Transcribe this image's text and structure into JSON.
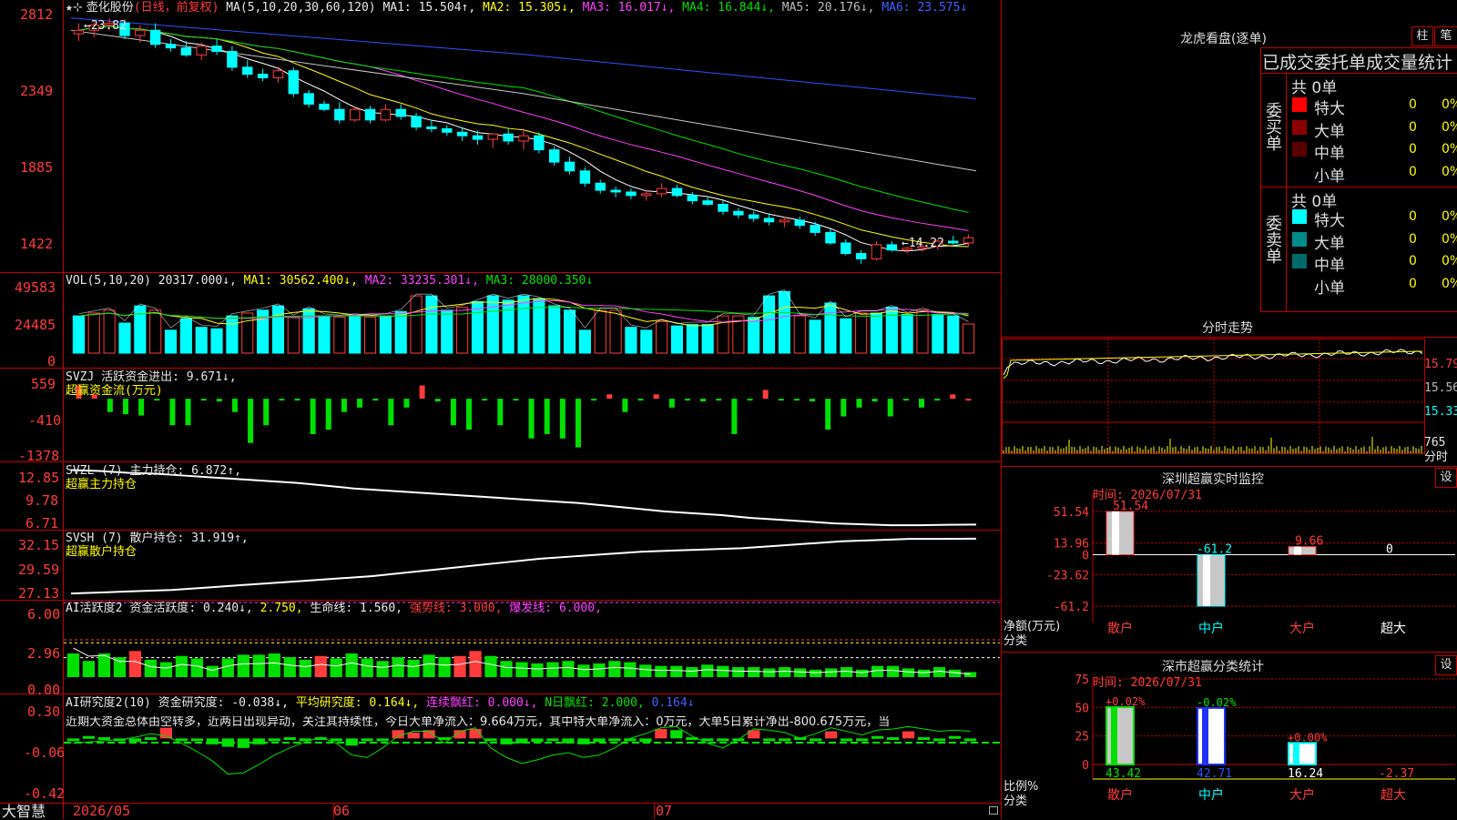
{
  "app_name": "大智慧",
  "main": {
    "stock": "壶化股份",
    "period": "(日线，前复权)",
    "ma_title": "MA(5,10,20,30,60,120)",
    "ma1": "MA1: 15.504↑,",
    "ma2": "MA2: 15.305↓,",
    "ma3": "MA3: 16.017↓,",
    "ma4": "MA4: 16.844↓,",
    "ma5": "MA5: 20.176↓,",
    "ma6": "MA6: 23.575↓",
    "y_ticks": [
      "2812",
      "2349",
      "1885",
      "1422"
    ],
    "high_label": "←23.82",
    "low_label": "←14.22",
    "colors": {
      "up": "#ff3b3b",
      "down": "#00ffff",
      "ma1": "#ffffff",
      "ma2": "#ffff00",
      "ma3": "#ff40ff",
      "ma4": "#00e000",
      "ma5": "#c8c8c8",
      "ma6": "#3050ff"
    }
  },
  "vol": {
    "title": "VOL(5,10,20)",
    "value": "20317.000↓,",
    "ma1": "MA1: 30562.400↓,",
    "ma2": "MA2: 33235.301↓,",
    "ma3": "MA3: 28000.350↓",
    "y_ticks": [
      "49583",
      "24485",
      "0"
    ]
  },
  "svzj": {
    "title": "SVZJ",
    "label": "活跃资金进出: 9.671↓,",
    "sub": "超赢资金流(万元)",
    "y_ticks": [
      "559",
      "-410",
      "-1378"
    ]
  },
  "svzl": {
    "title": "SVZL (7)",
    "label": "主力持仓: 6.872↑,",
    "sub": "超赢主力持仓",
    "y_ticks": [
      "12.85",
      "9.78",
      "6.71"
    ]
  },
  "svsh": {
    "title": "SVSH (7)",
    "label": "散户持仓: 31.919↑,",
    "sub": "超赢散户持仓",
    "y_ticks": [
      "32.15",
      "29.59",
      "27.13"
    ]
  },
  "ai_act": {
    "title": "AI活跃度2",
    "a": "资金活跃度: 0.240↓,",
    "b": "2.750,",
    "c": "生命线: 1.560,",
    "d": "强势线: 3.000,",
    "e": "爆发线: 6.000,",
    "y_ticks": [
      "6.00",
      "2.96",
      "0.00"
    ]
  },
  "ai_res": {
    "title": "AI研究度2(10)",
    "a": "资金研究度: -0.038↓,",
    "b": "平均研究度: 0.164↓,",
    "c": "连续飘红: 0.000↓,",
    "d": "N日飘红: 2.000,",
    "e": "0.164↓",
    "comment": "近期大资金总体由空转多，近两日出现异动，关注其持续性，今日大单净流入：9.664万元，其中特大单净流入：0万元，大单5日累计净出-800.675万元，当",
    "y_ticks": [
      "0.30",
      "-0.06",
      "-0.42"
    ]
  },
  "x_axis": [
    "2026/05",
    "06",
    "07"
  ],
  "longhu": {
    "title": "龙虎看盘(逐单)",
    "btn1": "柱",
    "btn2": "笔",
    "header": "已成交委托单成交量统计",
    "buy_label": "委买单",
    "sell_label": "委卖单",
    "buy_total": "共 0单",
    "sell_total": "共 0单",
    "buy_rows": [
      {
        "name": "特大",
        "count": "0",
        "pct": "0%",
        "color": "#ff0000"
      },
      {
        "name": "大单",
        "count": "0",
        "pct": "0%",
        "color": "#8b0000"
      },
      {
        "name": "中单",
        "count": "0",
        "pct": "0%",
        "color": "#5a0000"
      },
      {
        "name": "小单",
        "count": "0",
        "pct": "0%",
        "color": "#000000"
      }
    ],
    "sell_rows": [
      {
        "name": "特大",
        "count": "0",
        "pct": "0%",
        "color": "#00ffff"
      },
      {
        "name": "大单",
        "count": "0",
        "pct": "0%",
        "color": "#008b8b"
      },
      {
        "name": "中单",
        "count": "0",
        "pct": "0%",
        "color": "#006a6a"
      },
      {
        "name": "小单",
        "count": "0",
        "pct": "0%",
        "color": "#000000"
      }
    ]
  },
  "fenshi": {
    "title": "分时走势",
    "p1": "15.79",
    "p2": "15.56",
    "p3": "15.33",
    "vol": "765",
    "unit": "分时"
  },
  "monitor": {
    "title": "深圳超赢实时监控",
    "btn": "设",
    "time": "时间: 2026/07/31",
    "y_ticks": [
      "51.54",
      "13.96",
      "0",
      "-23.62",
      "-61.2"
    ],
    "ylabel": "净额(万元)",
    "xlabel": "分类",
    "categories": [
      "散户",
      "中户",
      "大户",
      "超大"
    ],
    "values": [
      51.54,
      -61.2,
      9.66,
      0
    ],
    "value_labels": [
      "51.54",
      "-61.2",
      "9.66",
      "0"
    ]
  },
  "classify": {
    "title": "深市超赢分类统计",
    "btn": "设",
    "time": "时间: 2026/07/31",
    "y_ticks": [
      "75",
      "50",
      "25",
      "0"
    ],
    "ylabel": "比例%",
    "xlabel": "分类",
    "categories": [
      "散户",
      "中户",
      "大户",
      "超大"
    ],
    "top_labels": [
      "+0.02%",
      "-0.02%",
      "+0.00%",
      ""
    ],
    "bottom_labels": [
      "43.42",
      "42.71",
      "16.24",
      "-2.37"
    ],
    "values": [
      43.42,
      42.71,
      16.24,
      -2.37
    ]
  },
  "chart_data": [
    {
      "type": "candlestick",
      "title": "壶化股份 (日线，前复权)",
      "ylim": [
        14.0,
        28.5
      ],
      "ohlc": [
        [
          27.3,
          27.9,
          26.9,
          27.5
        ],
        [
          27.5,
          28.0,
          27.1,
          27.8
        ],
        [
          27.8,
          28.2,
          27.5,
          27.9
        ],
        [
          27.9,
          28.1,
          27.0,
          27.2
        ],
        [
          27.2,
          27.8,
          26.8,
          27.5
        ],
        [
          27.5,
          27.9,
          26.5,
          26.7
        ],
        [
          26.7,
          27.0,
          26.3,
          26.5
        ],
        [
          26.5,
          26.9,
          26.0,
          26.1
        ],
        [
          26.1,
          26.8,
          25.8,
          26.6
        ],
        [
          26.6,
          27.0,
          26.1,
          26.3
        ],
        [
          26.3,
          26.6,
          25.2,
          25.4
        ],
        [
          25.4,
          25.8,
          24.8,
          25.0
        ],
        [
          25.0,
          25.3,
          24.6,
          24.8
        ],
        [
          24.8,
          25.4,
          24.5,
          25.2
        ],
        [
          25.2,
          25.4,
          23.7,
          23.9
        ],
        [
          23.9,
          24.1,
          23.1,
          23.3
        ],
        [
          23.3,
          23.5,
          22.9,
          23.0
        ],
        [
          23.0,
          23.4,
          22.2,
          22.4
        ],
        [
          22.4,
          23.2,
          22.3,
          23.0
        ],
        [
          23.0,
          23.2,
          22.2,
          22.4
        ],
        [
          22.4,
          23.3,
          22.3,
          23.0
        ],
        [
          23.0,
          23.3,
          22.4,
          22.6
        ],
        [
          22.6,
          22.8,
          21.8,
          22.0
        ],
        [
          22.0,
          22.4,
          21.7,
          21.9
        ],
        [
          21.9,
          22.1,
          21.5,
          21.7
        ],
        [
          21.7,
          22.0,
          21.2,
          21.5
        ],
        [
          21.5,
          21.8,
          21.0,
          21.3
        ],
        [
          21.3,
          21.6,
          20.8,
          21.6
        ],
        [
          21.6,
          21.9,
          21.0,
          21.2
        ],
        [
          21.2,
          21.9,
          20.7,
          21.5
        ],
        [
          21.5,
          21.7,
          20.5,
          20.7
        ],
        [
          20.7,
          20.9,
          19.8,
          20.0
        ],
        [
          20.0,
          20.3,
          19.3,
          19.5
        ],
        [
          19.5,
          19.7,
          18.6,
          18.8
        ],
        [
          18.8,
          19.0,
          18.2,
          18.4
        ],
        [
          18.4,
          18.6,
          18.0,
          18.3
        ],
        [
          18.3,
          18.5,
          17.9,
          18.1
        ],
        [
          18.1,
          18.4,
          17.8,
          18.2
        ],
        [
          18.2,
          18.8,
          18.0,
          18.5
        ],
        [
          18.5,
          18.7,
          18.0,
          18.1
        ],
        [
          18.1,
          18.3,
          17.6,
          17.8
        ],
        [
          17.8,
          18.0,
          17.5,
          17.6
        ],
        [
          17.6,
          17.8,
          17.0,
          17.2
        ],
        [
          17.2,
          17.4,
          16.8,
          17.0
        ],
        [
          17.0,
          17.2,
          16.6,
          16.8
        ],
        [
          16.8,
          17.1,
          16.4,
          16.6
        ],
        [
          16.6,
          16.9,
          16.3,
          16.7
        ],
        [
          16.7,
          16.9,
          16.2,
          16.4
        ],
        [
          16.4,
          16.6,
          15.8,
          16.0
        ],
        [
          16.0,
          16.2,
          15.3,
          15.4
        ],
        [
          15.4,
          15.6,
          14.7,
          14.8
        ],
        [
          14.8,
          15.0,
          14.2,
          14.5
        ],
        [
          14.5,
          15.5,
          14.4,
          15.3
        ],
        [
          15.3,
          15.5,
          14.9,
          15.0
        ],
        [
          15.0,
          15.2,
          14.8,
          15.1
        ],
        [
          15.1,
          15.3,
          14.9,
          15.2
        ],
        [
          15.2,
          15.6,
          15.0,
          15.5
        ],
        [
          15.5,
          15.8,
          15.3,
          15.4
        ],
        [
          15.4,
          15.9,
          15.2,
          15.7
        ]
      ],
      "ma_series": [
        {
          "name": "MA1"
        },
        {
          "name": "MA2"
        },
        {
          "name": "MA3"
        },
        {
          "name": "MA4"
        },
        {
          "name": "MA5"
        },
        {
          "name": "MA6"
        }
      ]
    },
    {
      "type": "bar",
      "title": "VOL(5,10,20)",
      "ylim": [
        0,
        49583
      ],
      "values": [
        26000,
        28000,
        30000,
        21000,
        33000,
        30000,
        16000,
        24000,
        18000,
        17000,
        26000,
        28000,
        30000,
        33000,
        25000,
        31000,
        26000,
        25000,
        26000,
        25000,
        26000,
        29000,
        40000,
        40000,
        30000,
        32000,
        36000,
        40000,
        37000,
        40000,
        38000,
        33000,
        30000,
        16000,
        30000,
        30000,
        18000,
        16000,
        22000,
        19000,
        20000,
        20000,
        26000,
        26000,
        25000,
        40000,
        43000,
        26000,
        23000,
        35000,
        24000,
        28000,
        28000,
        32000,
        27000,
        30000,
        27000,
        26000,
        20317
      ],
      "up": [
        0,
        1,
        1,
        0,
        0,
        1,
        0,
        0,
        0,
        0,
        0,
        1,
        0,
        0,
        1,
        0,
        0,
        1,
        0,
        1,
        0,
        0,
        1,
        0,
        0,
        1,
        0,
        0,
        0,
        0,
        0,
        0,
        0,
        0,
        1,
        1,
        0,
        0,
        1,
        0,
        0,
        0,
        1,
        1,
        0,
        0,
        0,
        1,
        0,
        0,
        0,
        1,
        0,
        0,
        0,
        1,
        0,
        0,
        1
      ]
    },
    {
      "type": "bar",
      "title": "SVZJ 活跃资金进出",
      "ylim": [
        -1378,
        559
      ],
      "values": [
        300,
        100,
        -300,
        -350,
        -380,
        -40,
        -600,
        -600,
        -40,
        -60,
        -300,
        -1000,
        -600,
        -40,
        -40,
        -800,
        -700,
        -300,
        -200,
        -40,
        -600,
        -200,
        300,
        -60,
        -600,
        -700,
        -40,
        -600,
        -40,
        -900,
        -800,
        -900,
        -1100,
        -40,
        100,
        -300,
        -40,
        100,
        -200,
        -40,
        -60,
        -40,
        -800,
        -40,
        200,
        -30,
        -30,
        -60,
        -700,
        -400,
        -200,
        -60,
        -400,
        -40,
        -200,
        -40,
        100,
        -10
      ],
      "up": [
        1,
        1,
        0,
        0,
        0,
        0,
        0,
        0,
        0,
        0,
        0,
        0,
        0,
        0,
        0,
        0,
        0,
        0,
        0,
        0,
        0,
        0,
        1,
        0,
        0,
        0,
        0,
        0,
        0,
        0,
        0,
        0,
        0,
        0,
        1,
        0,
        0,
        1,
        0,
        0,
        0,
        0,
        0,
        0,
        1,
        0,
        0,
        0,
        0,
        0,
        0,
        0,
        0,
        0,
        0,
        0,
        1,
        1
      ]
    },
    {
      "type": "line",
      "title": "SVZL 主力持仓",
      "ylim": [
        6.71,
        12.85
      ],
      "values": [
        12.8,
        12.7,
        12.5,
        12.4,
        12.2,
        12.0,
        11.8,
        11.6,
        11.4,
        11.1,
        10.8,
        10.6,
        10.4,
        10.2,
        10.0,
        9.8,
        9.6,
        9.4,
        9.2,
        8.9,
        8.6,
        8.3,
        8.1,
        7.9,
        7.6,
        7.4,
        7.2,
        7.0,
        6.9,
        6.8,
        6.8,
        6.85,
        6.87
      ]
    },
    {
      "type": "line",
      "title": "SVSH 散户持仓",
      "ylim": [
        27.13,
        32.15
      ],
      "values": [
        27.2,
        27.3,
        27.4,
        27.5,
        27.7,
        27.9,
        28.1,
        28.3,
        28.5,
        28.7,
        29.0,
        29.3,
        29.6,
        29.9,
        30.2,
        30.4,
        30.6,
        30.8,
        30.9,
        31.0,
        31.1,
        31.3,
        31.5,
        31.7,
        31.8,
        31.9,
        31.9,
        31.92
      ]
    },
    {
      "type": "bar",
      "title": "AI活跃度2",
      "ylim": [
        0,
        6
      ],
      "values": [
        1.9,
        1.3,
        1.9,
        1.6,
        2.1,
        1.4,
        1.2,
        1.7,
        1.5,
        0.9,
        1.5,
        1.8,
        1.8,
        1.9,
        1.6,
        1.4,
        1.7,
        1.5,
        1.9,
        1.5,
        1.3,
        1.6,
        1.4,
        1.8,
        1.6,
        1.7,
        2.1,
        1.7,
        1.3,
        1.2,
        1.1,
        1.2,
        1.3,
        1.0,
        1.1,
        1.3,
        1.2,
        1.0,
        0.9,
        0.9,
        0.8,
        1.0,
        0.9,
        0.8,
        0.8,
        0.7,
        0.8,
        0.7,
        0.6,
        0.7,
        0.8,
        0.6,
        0.9,
        0.9,
        0.7,
        0.6,
        0.8,
        0.6,
        0.4
      ],
      "up": [
        0,
        0,
        0,
        0,
        1,
        0,
        0,
        0,
        0,
        0,
        0,
        0,
        0,
        0,
        0,
        0,
        1,
        0,
        0,
        0,
        0,
        0,
        0,
        0,
        0,
        1,
        1,
        0,
        0,
        0,
        0,
        0,
        0,
        0,
        0,
        0,
        0,
        0,
        0,
        0,
        0,
        0,
        0,
        0,
        0,
        0,
        0,
        0,
        0,
        0,
        0,
        0,
        0,
        0,
        0,
        0,
        0,
        0,
        0
      ]
    },
    {
      "type": "bar",
      "title": "AI研究度2(10)",
      "ylim": [
        -0.42,
        0.3
      ],
      "values": [
        -0.05,
        -0.02,
        -0.03,
        -0.06,
        -0.07,
        -0.03,
        0.05,
        -0.05,
        -0.06,
        -0.09,
        -0.11,
        -0.12,
        -0.09,
        -0.05,
        -0.03,
        -0.05,
        -0.03,
        -0.05,
        -0.1,
        -0.04,
        -0.06,
        0.03,
        0.01,
        0.03,
        -0.03,
        0.03,
        0.04,
        -0.06,
        -0.09,
        -0.08,
        -0.07,
        -0.06,
        -0.08,
        -0.09,
        -0.07,
        -0.06,
        -0.05,
        -0.07,
        0.04,
        0.03,
        -0.03,
        -0.04,
        -0.05,
        -0.05,
        0.03,
        -0.06,
        -0.04,
        -0.03,
        -0.05,
        0.02,
        -0.06,
        -0.04,
        -0.02,
        -0.03,
        0.02,
        -0.03,
        -0.04,
        -0.02,
        -0.04
      ],
      "up": [
        0,
        0,
        0,
        0,
        0,
        0,
        1,
        0,
        0,
        0,
        0,
        0,
        0,
        0,
        0,
        0,
        0,
        0,
        0,
        0,
        0,
        1,
        1,
        1,
        0,
        1,
        1,
        0,
        0,
        0,
        0,
        0,
        0,
        0,
        0,
        0,
        0,
        0,
        1,
        0,
        0,
        0,
        0,
        0,
        1,
        0,
        0,
        0,
        0,
        1,
        0,
        0,
        0,
        0,
        1,
        0,
        0,
        0,
        0
      ]
    }
  ]
}
